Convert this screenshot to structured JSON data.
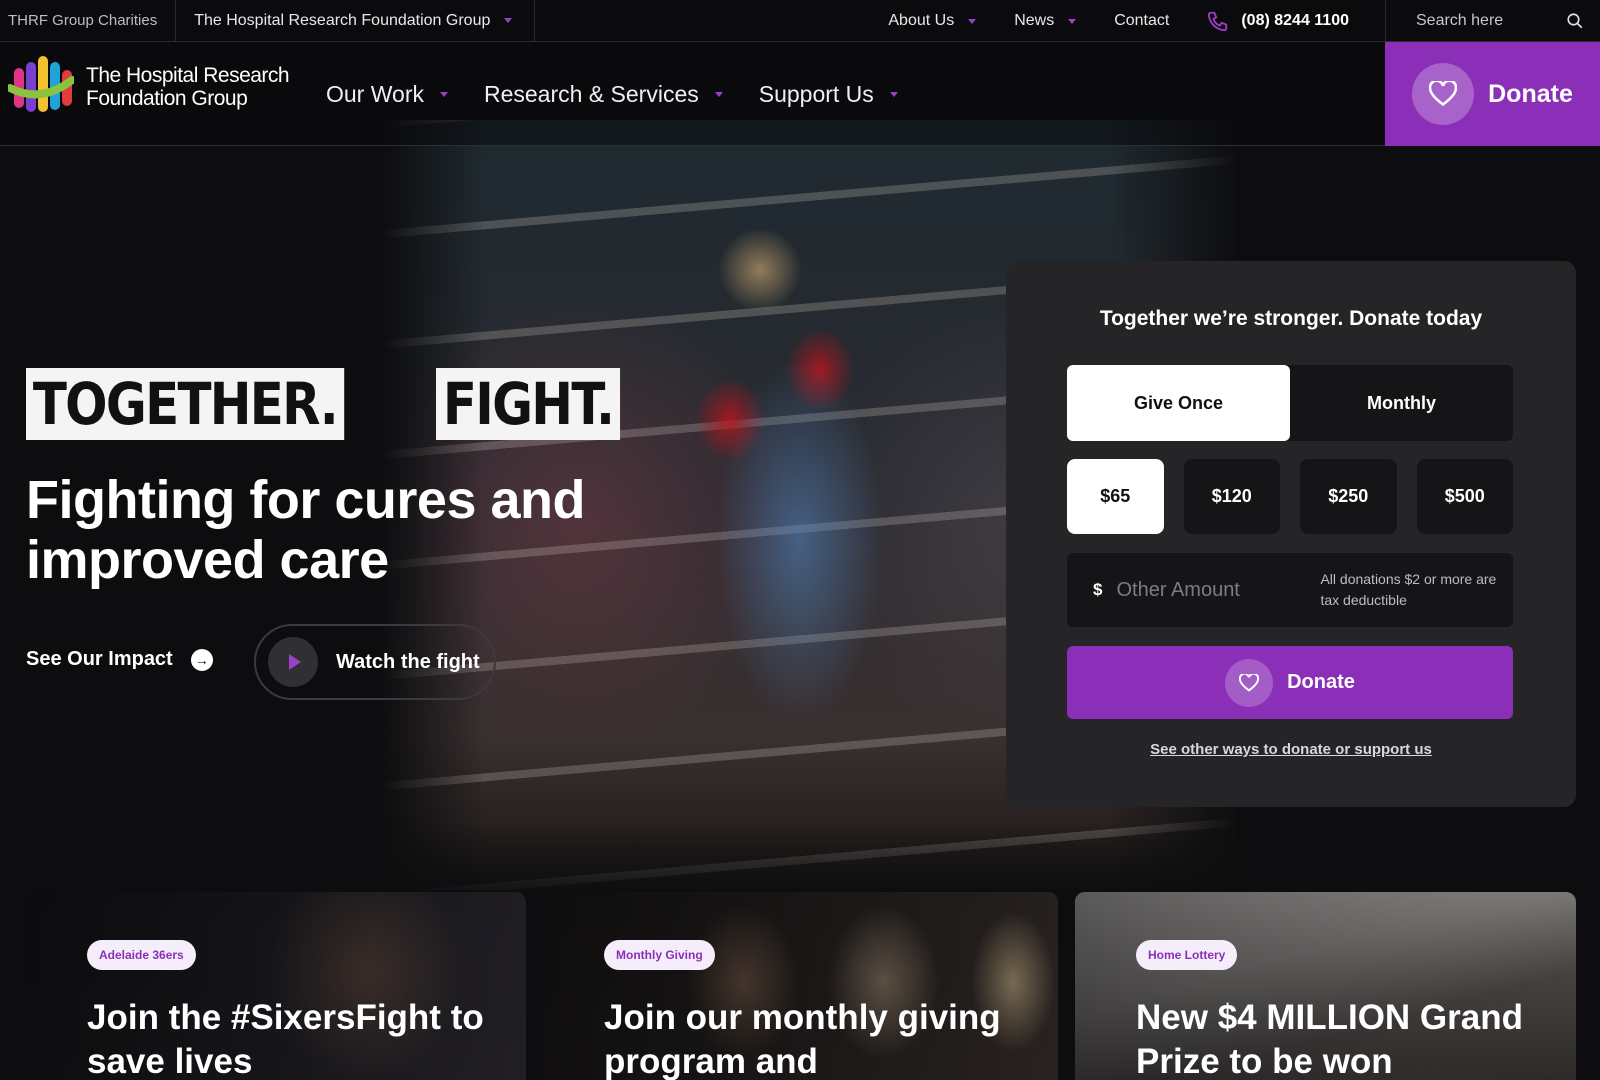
{
  "topbar": {
    "charities": "THRF Group Charities",
    "group": "The Hospital Research Foundation Group",
    "links": [
      "About Us",
      "News",
      "Contact"
    ],
    "phone": "(08) 8244 1100",
    "search_placeholder": "Search here"
  },
  "nav": {
    "logo_line1": "The Hospital Research",
    "logo_line2": "Foundation Group",
    "items": [
      "Our Work",
      "Research & Services",
      "Support Us"
    ],
    "donate": "Donate"
  },
  "hero": {
    "word1": "TOGETHER.",
    "word2": "FIGHT.",
    "title": "Fighting for cures and improved care",
    "impact": "See Our Impact",
    "watch": "Watch the fight"
  },
  "donate_panel": {
    "title": "Together we’re stronger. Donate today",
    "frequency": [
      "Give Once",
      "Monthly"
    ],
    "selected_frequency": "Give Once",
    "amounts": [
      "$65",
      "$120",
      "$250",
      "$500"
    ],
    "selected_amount": "$65",
    "currency_symbol": "$",
    "other_placeholder": "Other Amount",
    "tax_note": "All donations $2 or more are tax deductible",
    "donate_button": "Donate",
    "other_ways": "See other ways to donate or support us"
  },
  "cards": [
    {
      "tag": "Adelaide 36ers",
      "title": "Join the #SixersFight to save lives"
    },
    {
      "tag": "Monthly Giving",
      "title": "Join our monthly giving program and"
    },
    {
      "tag": "Home Lottery",
      "title": "New $4 MILLION Grand Prize to be won"
    }
  ],
  "colors": {
    "accent": "#8b2fb8",
    "background": "#0d0d0f",
    "panel": "#252527"
  }
}
